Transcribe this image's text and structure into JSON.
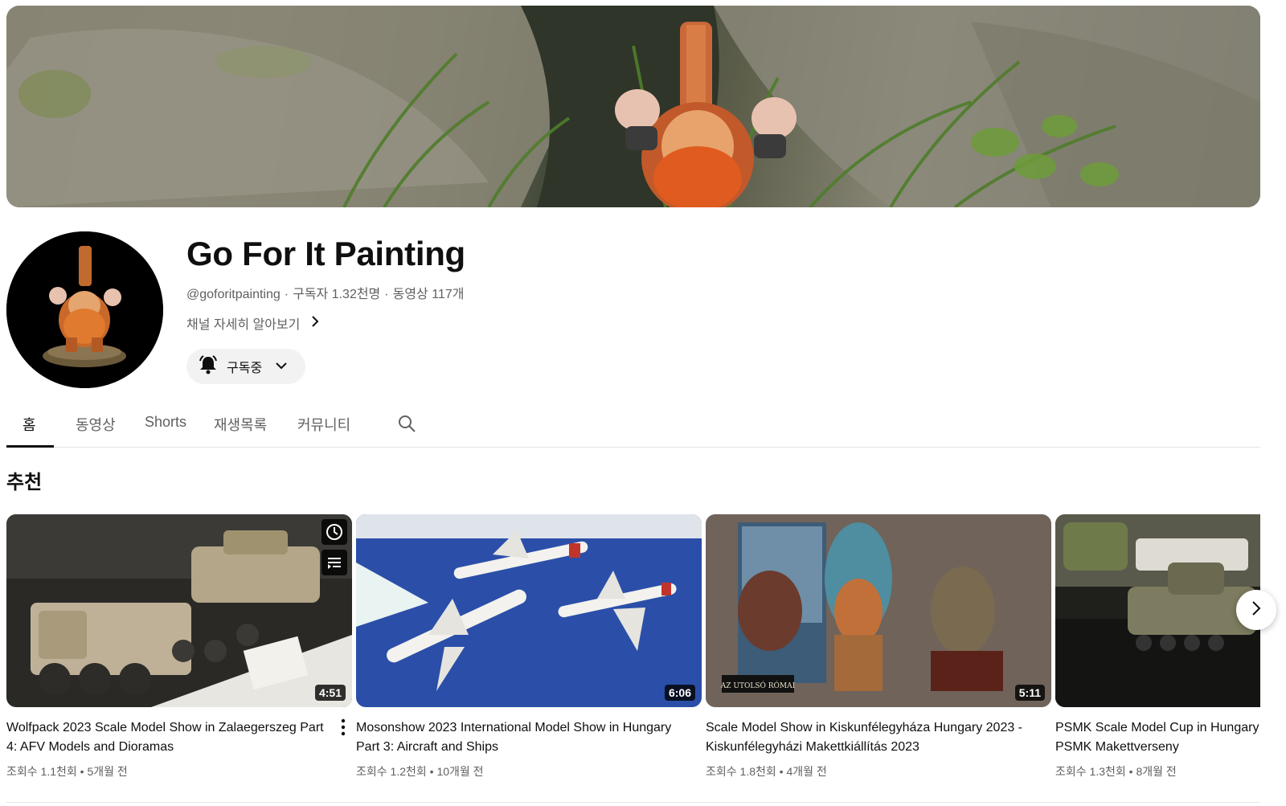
{
  "channel": {
    "title": "Go For It Painting",
    "handle": "@goforitpainting",
    "subscribers": "구독자 1.32천명",
    "videos": "동영상 117개",
    "about_link": "채널 자세히 알아보기",
    "subscribe_label": "구독중"
  },
  "tabs": [
    {
      "label": "홈",
      "active": true
    },
    {
      "label": "동영상"
    },
    {
      "label": "Shorts"
    },
    {
      "label": "재생목록"
    },
    {
      "label": "커뮤니티"
    }
  ],
  "section": {
    "title": "추천"
  },
  "videos": [
    {
      "title": "Wolfpack 2023 Scale Model Show in Zalaegerszeg Part 4: AFV Models and Dioramas",
      "duration": "4:51",
      "views": "조회수 1.1천회",
      "age": "5개월 전"
    },
    {
      "title": "Mosonshow 2023 International Model Show in Hungary Part 3: Aircraft and Ships",
      "duration": "6:06",
      "views": "조회수 1.2천회",
      "age": "10개월 전"
    },
    {
      "title": "Scale Model Show in Kiskunfélegyháza Hungary 2023 - Kiskunfélegyházi Makettkiállítás 2023",
      "duration": "5:11",
      "views": "조회수 1.8천회",
      "age": "4개월 전"
    },
    {
      "title": "PSMK Scale Model Cup in Hungary vehicles and Dioramas - PSMK Makettverseny",
      "views": "조회수 1.3천회",
      "age": "8개월 전"
    }
  ],
  "thumb_texts": {
    "plaque": "AZ UTOLSÓ RÓMAI"
  },
  "icons": {
    "watch_later": "clock-icon",
    "add_queue": "queue-icon",
    "more": "more-vert-icon",
    "search": "search-icon",
    "bell": "bell-icon",
    "chevron": "chevron-down-icon",
    "next": "chevron-right-icon"
  },
  "colors": {
    "text_primary": "#0f0f0f",
    "text_secondary": "#606060",
    "chip_bg": "#f2f2f2",
    "divider": "#e5e5e5"
  }
}
